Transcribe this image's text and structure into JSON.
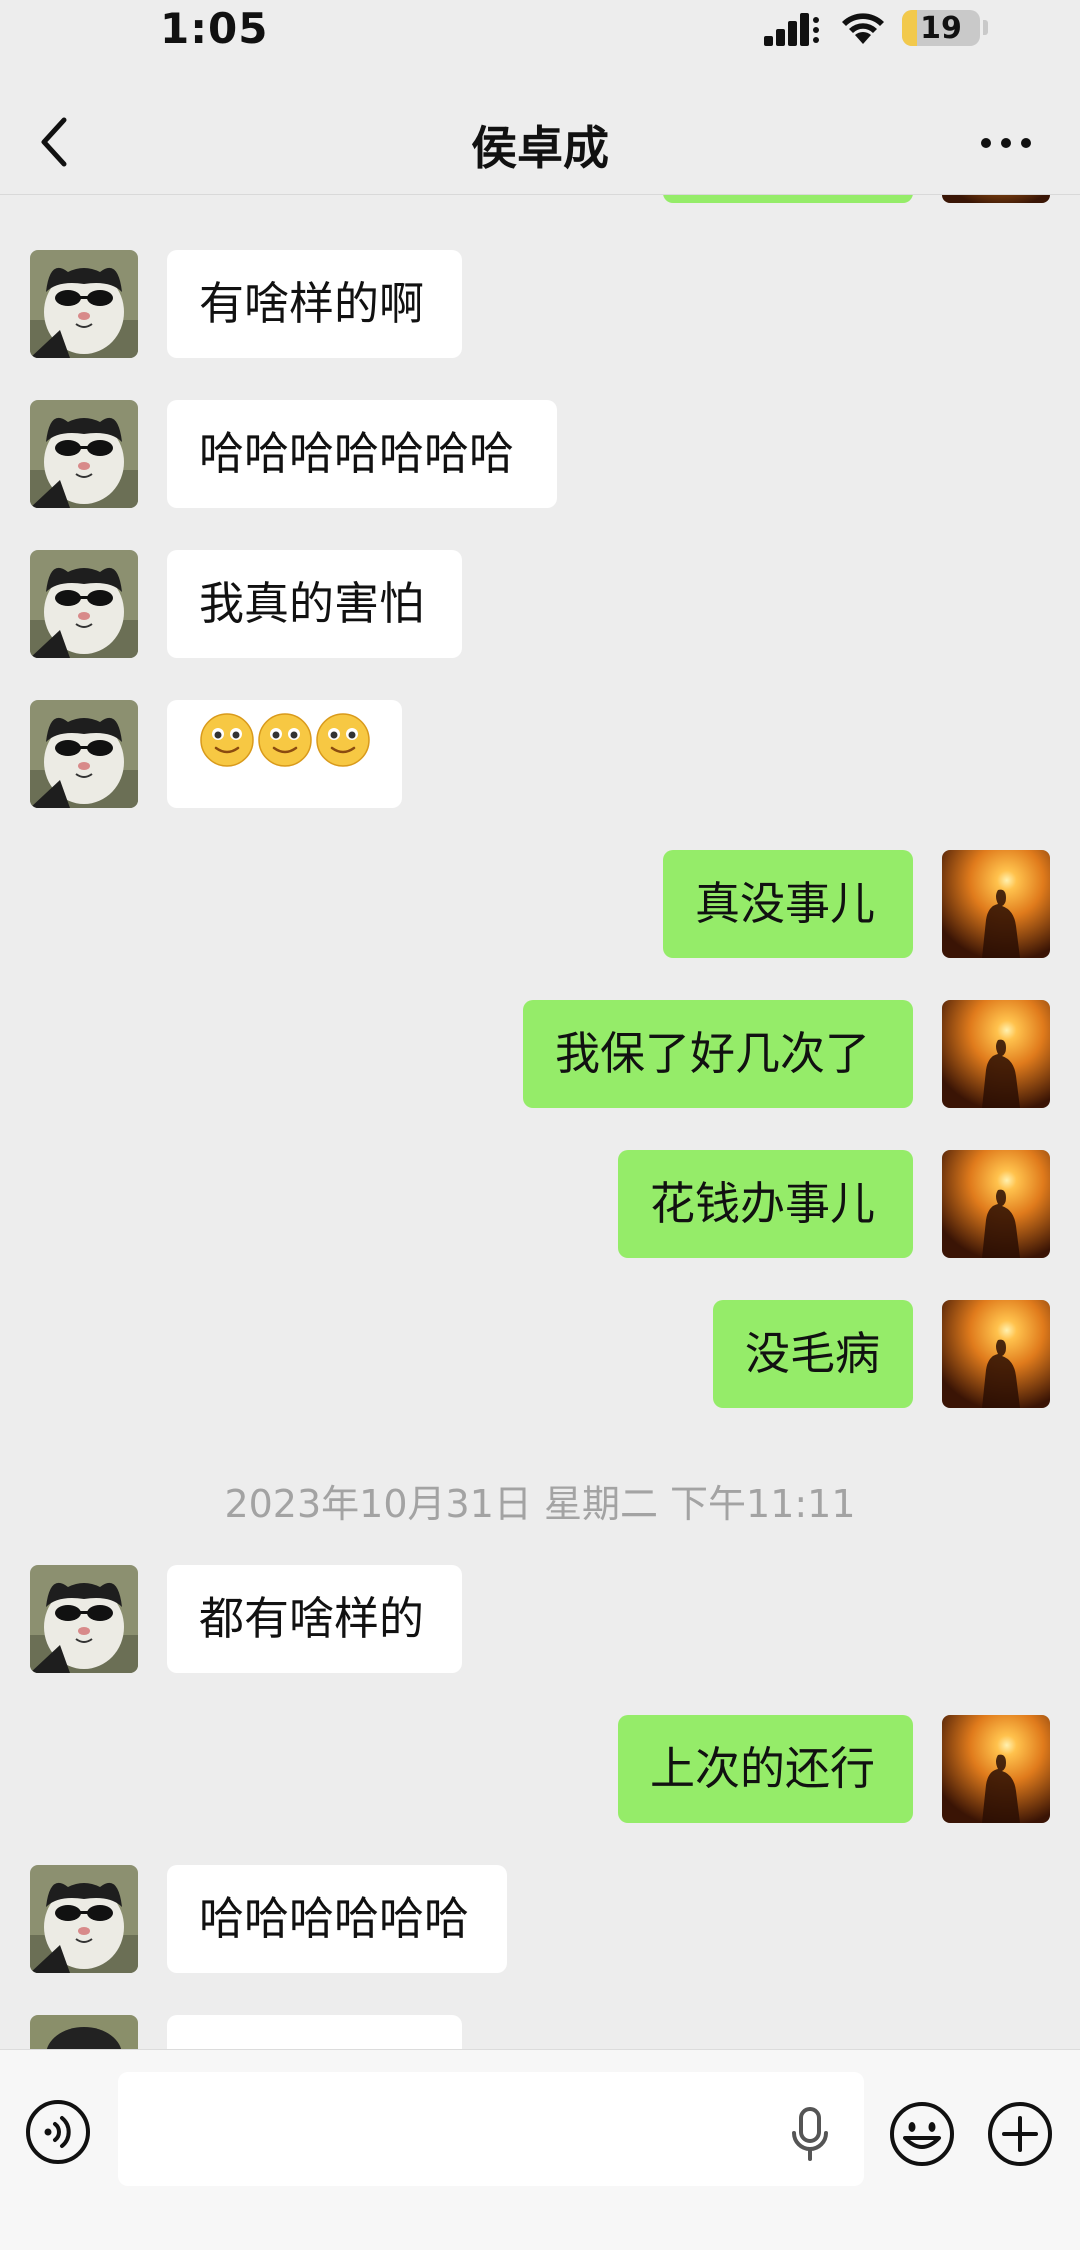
{
  "status_bar": {
    "time": "1:05",
    "battery_level": "19",
    "battery_fraction": 0.19
  },
  "nav": {
    "title": "侯卓成"
  },
  "messages": [
    {
      "side": "left",
      "text": "有啥样的啊"
    },
    {
      "side": "left",
      "text": "哈哈哈哈哈哈哈"
    },
    {
      "side": "left",
      "text": "我真的害怕"
    },
    {
      "side": "left",
      "emoji": "smile-emoji",
      "emoji_count": 3
    },
    {
      "side": "right",
      "text": "真没事儿"
    },
    {
      "side": "right",
      "text": "我保了好几次了"
    },
    {
      "side": "right",
      "text": "花钱办事儿"
    },
    {
      "side": "right",
      "text": "没毛病"
    },
    {
      "side": "left",
      "text": "都有啥样的"
    },
    {
      "side": "right",
      "text": "上次的还行"
    },
    {
      "side": "left",
      "text": "哈哈哈哈哈哈"
    }
  ],
  "timestamp": "2023年10月31日 星期二 下午11:11",
  "input": {
    "placeholder": "",
    "value": ""
  },
  "colors": {
    "background": "#ededed",
    "sent_bubble": "#95ec69",
    "received_bubble": "#ffffff",
    "timestamp_text": "#a3a3a3"
  },
  "icons": {
    "back": "chevron-left-icon",
    "more": "more-dots-icon",
    "voice": "voice-toggle-icon",
    "mic": "microphone-icon",
    "emoji": "emoji-face-icon",
    "plus": "plus-circle-icon"
  }
}
